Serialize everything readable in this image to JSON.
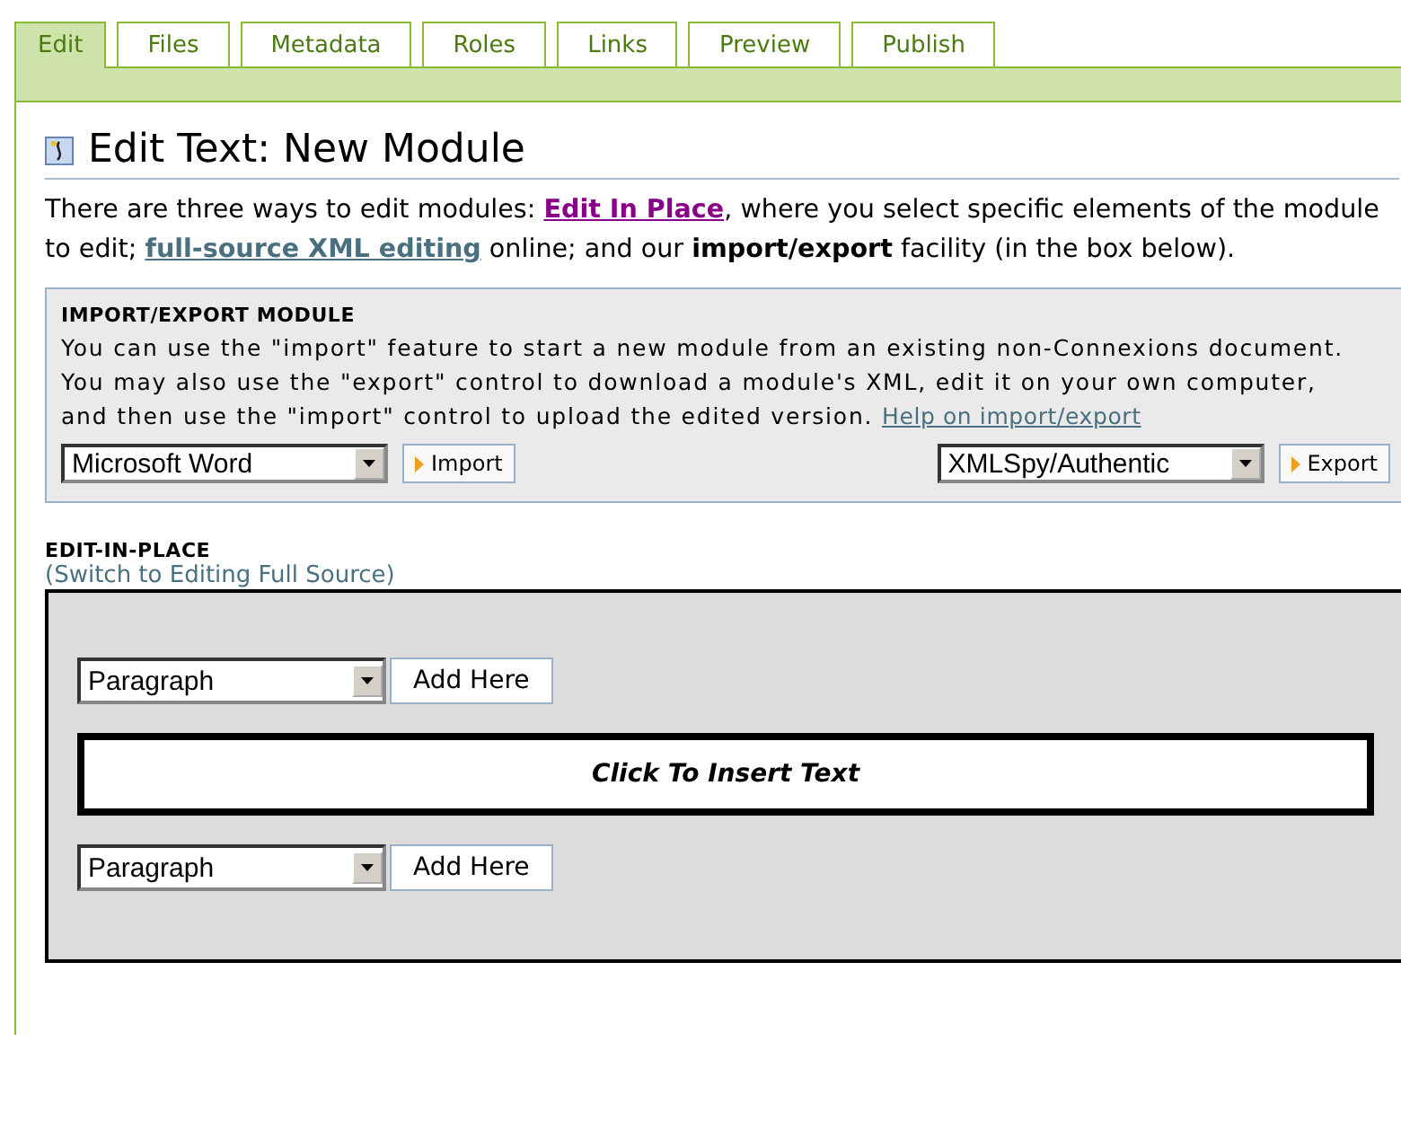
{
  "tabs": [
    {
      "label": "Edit",
      "selected": true
    },
    {
      "label": "Files",
      "selected": false
    },
    {
      "label": "Metadata",
      "selected": false
    },
    {
      "label": "Roles",
      "selected": false
    },
    {
      "label": "Links",
      "selected": false
    },
    {
      "label": "Preview",
      "selected": false
    },
    {
      "label": "Publish",
      "selected": false
    }
  ],
  "title": "Edit Text: New Module",
  "intro": [
    {
      "kind": "text",
      "text": "There are three ways to edit modules: "
    },
    {
      "kind": "link",
      "text": "Edit In Place",
      "visited": true
    },
    {
      "kind": "text",
      "text": ", where you select specific elements of the module to edit; "
    },
    {
      "kind": "link",
      "text": "full-source XML editing",
      "visited": false
    },
    {
      "kind": "text",
      "text": " online; and our "
    },
    {
      "kind": "bold",
      "text": "import/export"
    },
    {
      "kind": "text",
      "text": " facility (in the box below)."
    }
  ],
  "import_export": {
    "heading": "IMPORT/EXPORT MODULE",
    "description": "You can use the \"import\" feature to start a new module from an existing non-Connexions document. You may also use the \"export\" control to download a module's XML, edit it on your own computer, and then use the \"import\" control to upload the edited version.",
    "help_link": "Help on import/export",
    "import_select": "Microsoft Word",
    "import_button": "Import",
    "export_select": "XMLSpy/Authentic",
    "export_button": "Export"
  },
  "edit_in_place": {
    "heading": "EDIT-IN-PLACE",
    "switch_link": "(Switch to Editing Full Source)",
    "items": [
      {
        "kind": "add",
        "select": "Paragraph",
        "button": "Add Here"
      },
      {
        "kind": "insert",
        "text": "Click To Insert Text"
      },
      {
        "kind": "add",
        "select": "Paragraph",
        "button": "Add Here"
      }
    ]
  }
}
